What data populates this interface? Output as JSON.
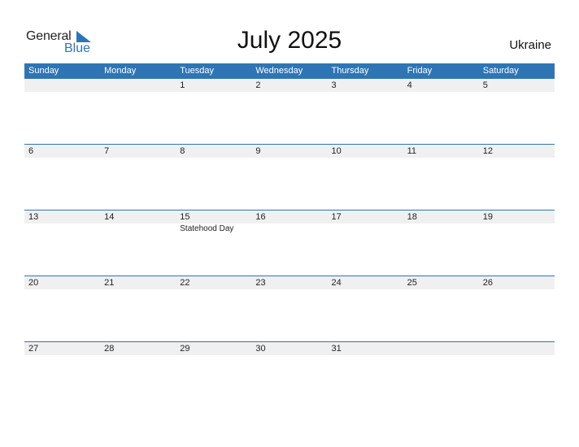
{
  "logo": {
    "general": "General",
    "blue": "Blue",
    "brand_color": "#2e75b6"
  },
  "title": "July 2025",
  "country": "Ukraine",
  "weekdays": [
    "Sunday",
    "Monday",
    "Tuesday",
    "Wednesday",
    "Thursday",
    "Friday",
    "Saturday"
  ],
  "weeks": [
    [
      "",
      "",
      "1",
      "2",
      "3",
      "4",
      "5"
    ],
    [
      "6",
      "7",
      "8",
      "9",
      "10",
      "11",
      "12"
    ],
    [
      "13",
      "14",
      "15",
      "16",
      "17",
      "18",
      "19"
    ],
    [
      "20",
      "21",
      "22",
      "23",
      "24",
      "25",
      "26"
    ],
    [
      "27",
      "28",
      "29",
      "30",
      "31",
      "",
      ""
    ]
  ],
  "holidays": [
    {
      "date": "15",
      "week": 2,
      "day": 2,
      "name": "Statehood Day"
    }
  ]
}
